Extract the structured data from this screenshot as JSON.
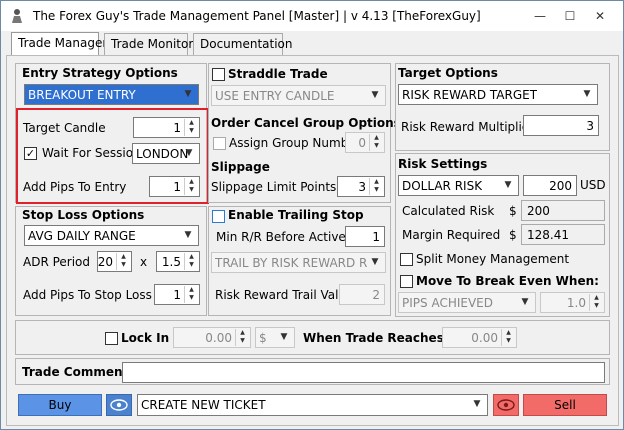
{
  "window": {
    "title": "The Forex Guy's Trade Management Panel [Master] | v 4.13 [TheForexGuy]",
    "minimize": "—",
    "maximize": "☐",
    "close": "✕"
  },
  "tabs": [
    "Trade Manager",
    "Trade Monitor",
    "Documentation"
  ],
  "entry": {
    "header": "Entry Strategy Options",
    "strategy": "BREAKOUT ENTRY",
    "target_candle_label": "Target Candle",
    "target_candle_value": "1",
    "wait_session_label": "Wait For Session",
    "wait_session_value": "LONDON",
    "add_pips_label": "Add Pips To Entry",
    "add_pips_value": "1"
  },
  "straddle": {
    "header": "Straddle Trade",
    "candle": "USE ENTRY CANDLE",
    "order_cancel_header": "Order Cancel Group Options",
    "assign_label": "Assign Group Number",
    "assign_value": "0",
    "slippage_header": "Slippage",
    "slippage_label": "Slippage Limit Points",
    "slippage_value": "3"
  },
  "target": {
    "header": "Target Options",
    "type": "RISK REWARD TARGET",
    "multiplier_label": "Risk Reward Multiplier",
    "multiplier_value": "3"
  },
  "risk": {
    "header": "Risk Settings",
    "type": "DOLLAR RISK",
    "amount": "200",
    "currency": "USD",
    "calc_label": "Calculated Risk",
    "calc_symbol": "$",
    "calc_value": "200",
    "margin_label": "Margin Required",
    "margin_symbol": "$",
    "margin_value": "128.41",
    "split_label": "Split Money Management",
    "breakeven_label": "Move To Break Even When:",
    "breakeven_type": "PIPS ACHIEVED",
    "breakeven_value": "1.0"
  },
  "stoploss": {
    "header": "Stop Loss Options",
    "type": "AVG DAILY RANGE",
    "adr_label": "ADR Period",
    "adr_value": "20",
    "times": "x",
    "mult_value": "1.5",
    "add_pips_label": "Add Pips To Stop Loss",
    "add_pips_value": "1"
  },
  "trailing": {
    "header": "Enable Trailing Stop",
    "min_rr_label": "Min R/R Before Active",
    "min_rr_value": "1",
    "method": "TRAIL BY RISK REWARD RAT",
    "trail_value_label": "Risk Reward Trail Value",
    "trail_value": "2"
  },
  "lockin": {
    "label": "Lock In",
    "amount": "0.00",
    "unit": "$",
    "when_label": "When Trade Reaches: $",
    "when_value": "0.00"
  },
  "comment": {
    "label": "Trade Comment:",
    "value": ""
  },
  "bottom": {
    "buy": "Buy",
    "ticket": "CREATE NEW TICKET",
    "sell": "Sell"
  },
  "colors": {
    "buy": "#5b94e6",
    "sell": "#f36b68",
    "select_blue": "#2f6fcf",
    "highlight": "#e0202a"
  }
}
